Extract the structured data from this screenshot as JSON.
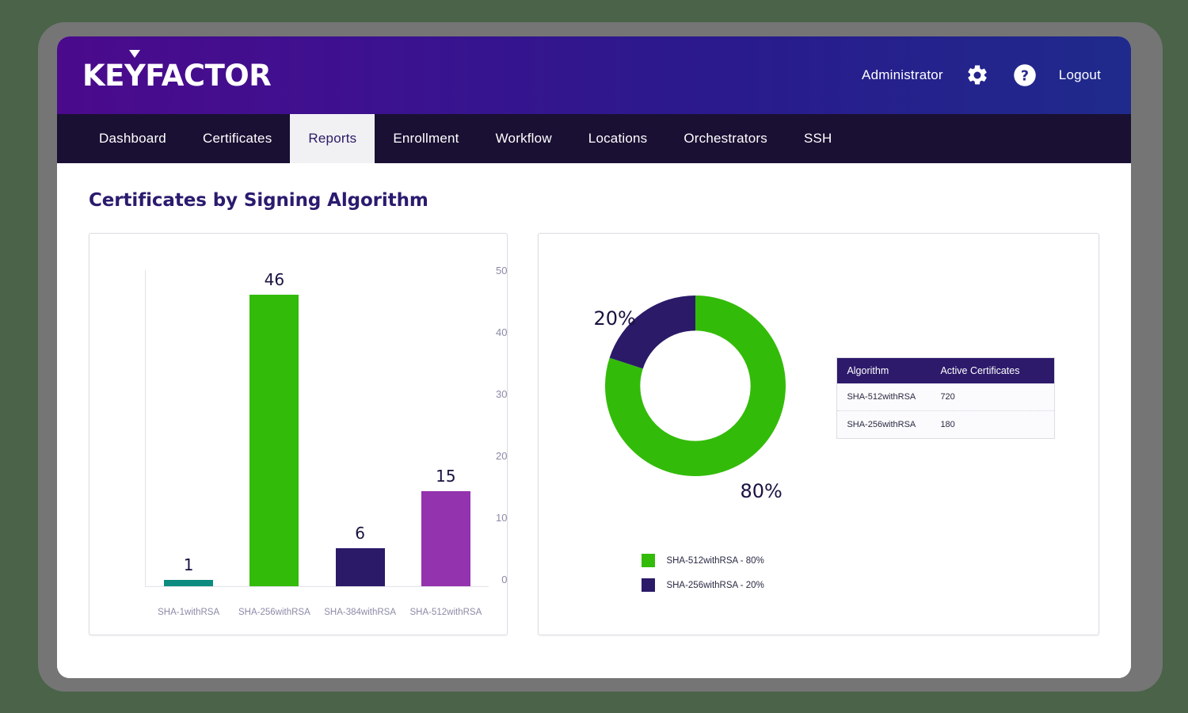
{
  "header": {
    "logo_text_part1": "KE",
    "logo_text_y": "Y",
    "logo_text_part2": "FACTOR",
    "user_label": "Administrator",
    "settings_icon": "gear-icon",
    "help_icon": "help-circle-icon",
    "logout_label": "Logout",
    "gradient_start": "#4b0a8c",
    "gradient_end": "#1f2a8c"
  },
  "nav": {
    "items": [
      {
        "label": "Dashboard",
        "active": false
      },
      {
        "label": "Certificates",
        "active": false
      },
      {
        "label": "Reports",
        "active": true
      },
      {
        "label": "Enrollment",
        "active": false
      },
      {
        "label": "Workflow",
        "active": false
      },
      {
        "label": "Locations",
        "active": false
      },
      {
        "label": "Orchestrators",
        "active": false
      },
      {
        "label": "SSH",
        "active": false
      }
    ],
    "background": "#1a1033",
    "active_background": "#f1f1f4",
    "active_color": "#2c1a63"
  },
  "page": {
    "title": "Certificates by Signing Algorithm",
    "title_color": "#2b1b6e"
  },
  "chart_data": [
    {
      "type": "bar",
      "title": "",
      "categories": [
        "SHA-1withRSA",
        "SHA-256withRSA",
        "SHA-384withRSA",
        "SHA-512withRSA"
      ],
      "values": [
        1,
        46,
        6,
        15
      ],
      "colors": [
        "#0d8b80",
        "#33bb09",
        "#2b1a68",
        "#9333ad"
      ],
      "xlabel": "",
      "ylabel": "",
      "ylim": [
        0,
        50
      ],
      "yticks": [
        50,
        40,
        30,
        20,
        10,
        0
      ],
      "grid": false,
      "data_labels": true,
      "legend": "none"
    },
    {
      "type": "pie",
      "variant": "donut",
      "title": "",
      "labels": [
        "SHA-512withRSA",
        "SHA-256withRSA"
      ],
      "values": [
        80,
        20
      ],
      "value_labels": [
        "80%",
        "20%"
      ],
      "colors": [
        "#33bb09",
        "#2b1a68"
      ],
      "legend": "bottom-left",
      "legend_entries": [
        "SHA-512withRSA - 80%",
        "SHA-256withRSA - 20%"
      ]
    }
  ],
  "table": {
    "headers": [
      "Algorithm",
      "Active Certificates"
    ],
    "rows": [
      [
        "SHA-512withRSA",
        "720"
      ],
      [
        "SHA-256withRSA",
        "180"
      ]
    ],
    "header_background": "#2d1a6b"
  }
}
